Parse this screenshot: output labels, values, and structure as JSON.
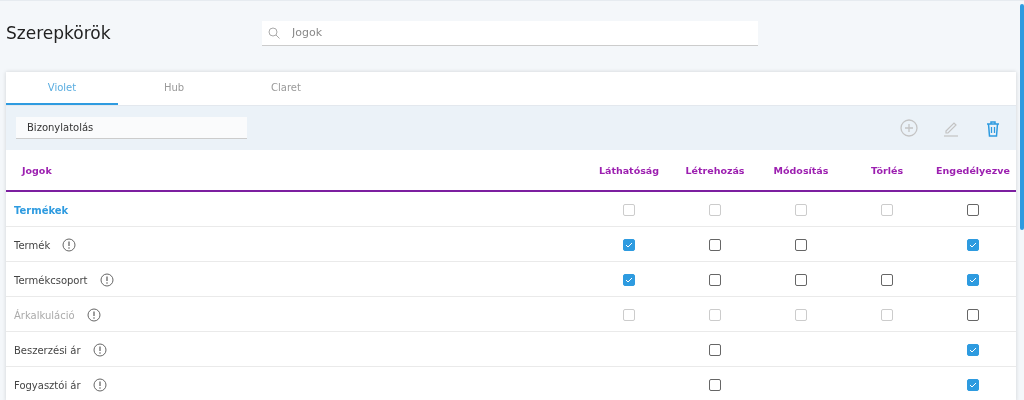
{
  "page": {
    "title": "Szerepkörök"
  },
  "search": {
    "placeholder": "Jogok"
  },
  "tabs": [
    {
      "label": "Violet",
      "selected": true
    },
    {
      "label": "Hub",
      "selected": false
    },
    {
      "label": "Claret",
      "selected": false
    }
  ],
  "module_field": {
    "value": "Bizonylatolás"
  },
  "toolbar": [
    {
      "kind": "add",
      "disabled": true
    },
    {
      "kind": "edit",
      "disabled": true
    },
    {
      "kind": "delete",
      "disabled": false
    }
  ],
  "table": {
    "columns": [
      "Jogok",
      "Láthatóság",
      "Létrehozás",
      "Módosítás",
      "Törlés",
      "Engedélyezve"
    ],
    "rows": [
      {
        "kind": "group",
        "name": "Termékek",
        "disabled": false,
        "cells": [
          {
            "checked": false,
            "disabled": true
          },
          {
            "checked": false,
            "disabled": true
          },
          {
            "checked": false,
            "disabled": true
          },
          {
            "checked": false,
            "disabled": true
          },
          {
            "checked": false,
            "disabled": false
          }
        ]
      },
      {
        "kind": "item",
        "name": "Termék",
        "disabled": false,
        "cells": [
          {
            "checked": true,
            "disabled": false
          },
          {
            "checked": false,
            "disabled": false
          },
          {
            "checked": false,
            "disabled": false
          },
          null,
          {
            "checked": true,
            "disabled": false
          }
        ]
      },
      {
        "kind": "item",
        "name": "Termékcsoport",
        "disabled": false,
        "cells": [
          {
            "checked": true,
            "disabled": false
          },
          {
            "checked": false,
            "disabled": false
          },
          {
            "checked": false,
            "disabled": false
          },
          {
            "checked": false,
            "disabled": false
          },
          {
            "checked": true,
            "disabled": false
          }
        ]
      },
      {
        "kind": "item",
        "name": "Árkalkuláció",
        "disabled": true,
        "cells": [
          {
            "checked": false,
            "disabled": true
          },
          {
            "checked": false,
            "disabled": true
          },
          {
            "checked": false,
            "disabled": true
          },
          {
            "checked": false,
            "disabled": true
          },
          {
            "checked": false,
            "disabled": false
          }
        ]
      },
      {
        "kind": "item",
        "name": "Beszerzési ár",
        "disabled": false,
        "cells": [
          null,
          {
            "checked": false,
            "disabled": false
          },
          null,
          null,
          {
            "checked": true,
            "disabled": false
          }
        ]
      },
      {
        "kind": "item",
        "name": "Fogyasztói ár",
        "disabled": false,
        "cells": [
          null,
          {
            "checked": false,
            "disabled": false
          },
          null,
          null,
          {
            "checked": true,
            "disabled": false
          }
        ]
      }
    ]
  }
}
